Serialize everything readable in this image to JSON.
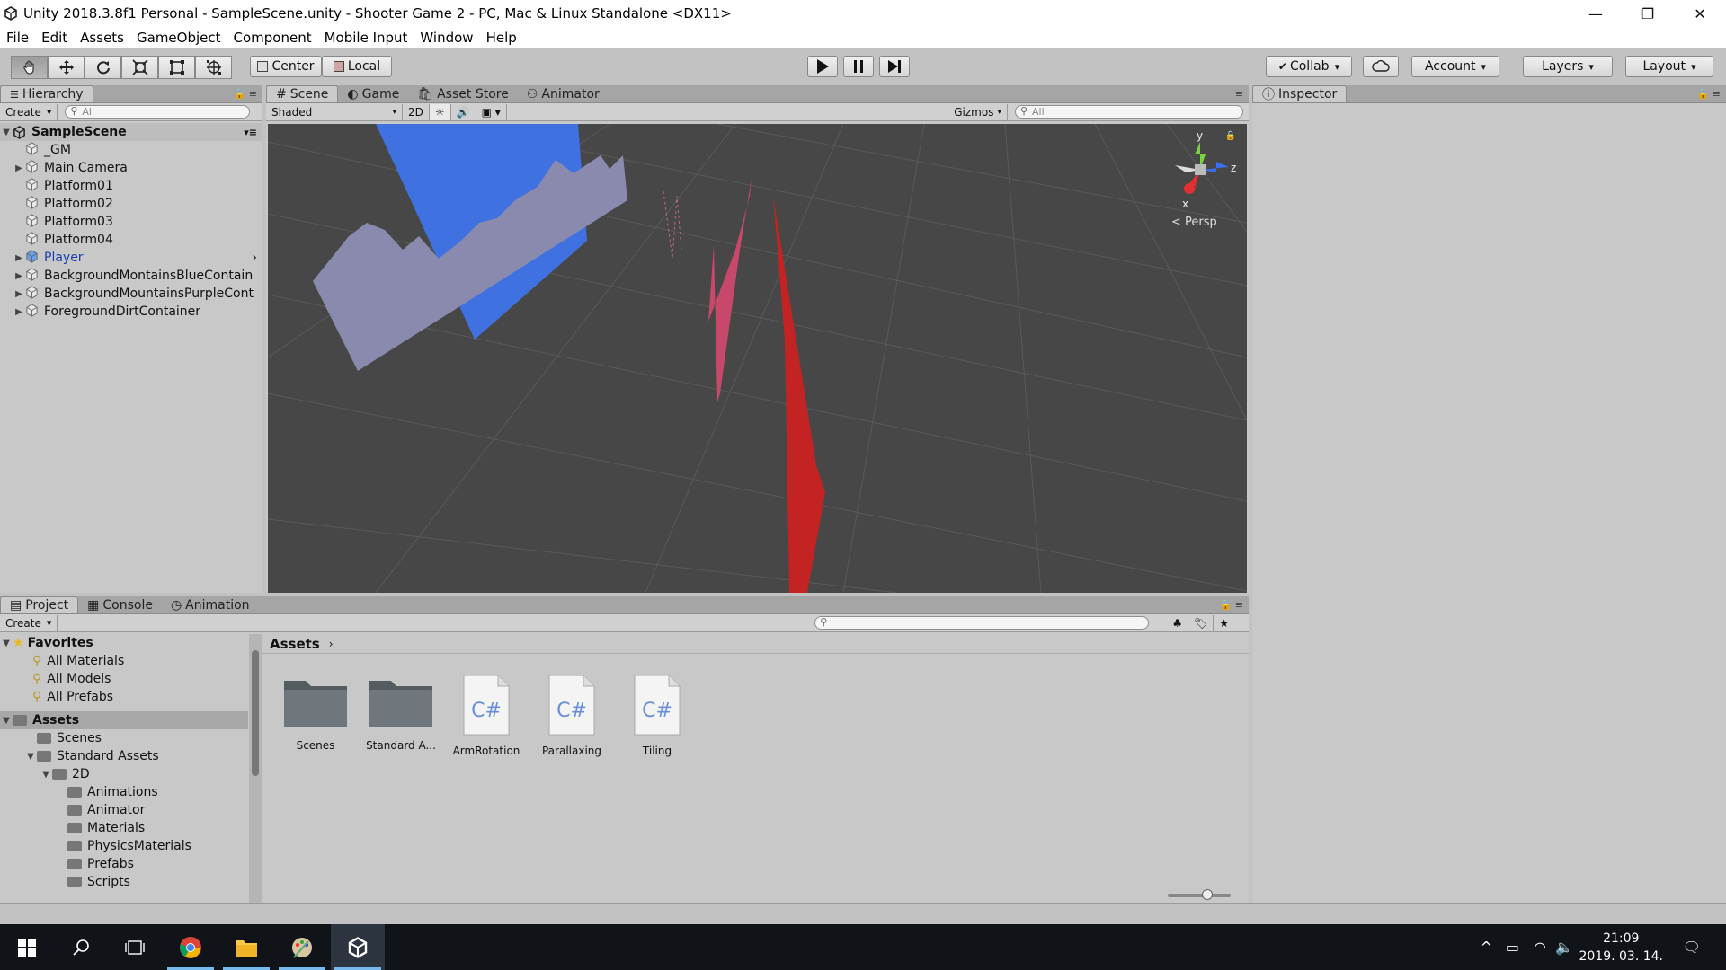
{
  "window": {
    "title": "Unity 2018.3.8f1 Personal - SampleScene.unity - Shooter Game 2 - PC, Mac & Linux Standalone <DX11>",
    "minimize_glyph": "—",
    "maximize_glyph": "❐",
    "close_glyph": "✕"
  },
  "menu": [
    "File",
    "Edit",
    "Assets",
    "GameObject",
    "Component",
    "Mobile Input",
    "Window",
    "Help"
  ],
  "toolbar": {
    "pivot_label": "Center",
    "space_label": "Local",
    "collab_label": "Collab",
    "account_label": "Account",
    "layers_label": "Layers",
    "layout_label": "Layout"
  },
  "hierarchy": {
    "tab_label": "Hierarchy",
    "create_label": "Create",
    "search_placeholder": "All",
    "scene_name": "SampleScene",
    "items": [
      {
        "label": "_GM",
        "expandable": false
      },
      {
        "label": "Main Camera",
        "expandable": true
      },
      {
        "label": "Platform01",
        "expandable": false
      },
      {
        "label": "Platform02",
        "expandable": false
      },
      {
        "label": "Platform03",
        "expandable": false
      },
      {
        "label": "Platform04",
        "expandable": false
      },
      {
        "label": "Player",
        "expandable": true,
        "prefab": true
      },
      {
        "label": "BackgroundMontainsBlueContain",
        "expandable": true
      },
      {
        "label": "BackgroundMountainsPurpleCont",
        "expandable": true
      },
      {
        "label": "ForegroundDirtContainer",
        "expandable": true
      }
    ]
  },
  "scene_view": {
    "tabs": [
      "Scene",
      "Game",
      "Asset Store",
      "Animator"
    ],
    "active_tab": "Scene",
    "shading_mode": "Shaded",
    "mode_2d_label": "2D",
    "gizmos_label": "Gizmos",
    "search_placeholder": "All",
    "projection_label": "Persp",
    "axis_y": "y",
    "axis_z": "z",
    "axis_x": "x"
  },
  "inspector": {
    "tab_label": "Inspector"
  },
  "project": {
    "tabs": [
      "Project",
      "Console",
      "Animation"
    ],
    "create_label": "Create",
    "favorites_label": "Favorites",
    "favorites": [
      "All Materials",
      "All Models",
      "All Prefabs"
    ],
    "assets_root_label": "Assets",
    "assets_tree": [
      {
        "label": "Scenes",
        "level": 1,
        "expandable": false
      },
      {
        "label": "Standard Assets",
        "level": 1,
        "expandable": true
      },
      {
        "label": "2D",
        "level": 2,
        "expandable": true
      },
      {
        "label": "Animations",
        "level": 3,
        "expandable": false
      },
      {
        "label": "Animator",
        "level": 3,
        "expandable": false
      },
      {
        "label": "Materials",
        "level": 3,
        "expandable": false
      },
      {
        "label": "PhysicsMaterials",
        "level": 3,
        "expandable": false
      },
      {
        "label": "Prefabs",
        "level": 3,
        "expandable": false
      },
      {
        "label": "Scripts",
        "level": 3,
        "expandable": false
      }
    ],
    "breadcrumb": "Assets",
    "grid_items": [
      {
        "label": "Scenes",
        "type": "folder"
      },
      {
        "label": "Standard A...",
        "type": "folder"
      },
      {
        "label": "ArmRotation",
        "type": "script"
      },
      {
        "label": "Parallaxing",
        "type": "script"
      },
      {
        "label": "Tiling",
        "type": "script"
      }
    ],
    "script_glyph": "C#"
  },
  "taskbar": {
    "time": "21:09",
    "date": "2019. 03. 14."
  }
}
